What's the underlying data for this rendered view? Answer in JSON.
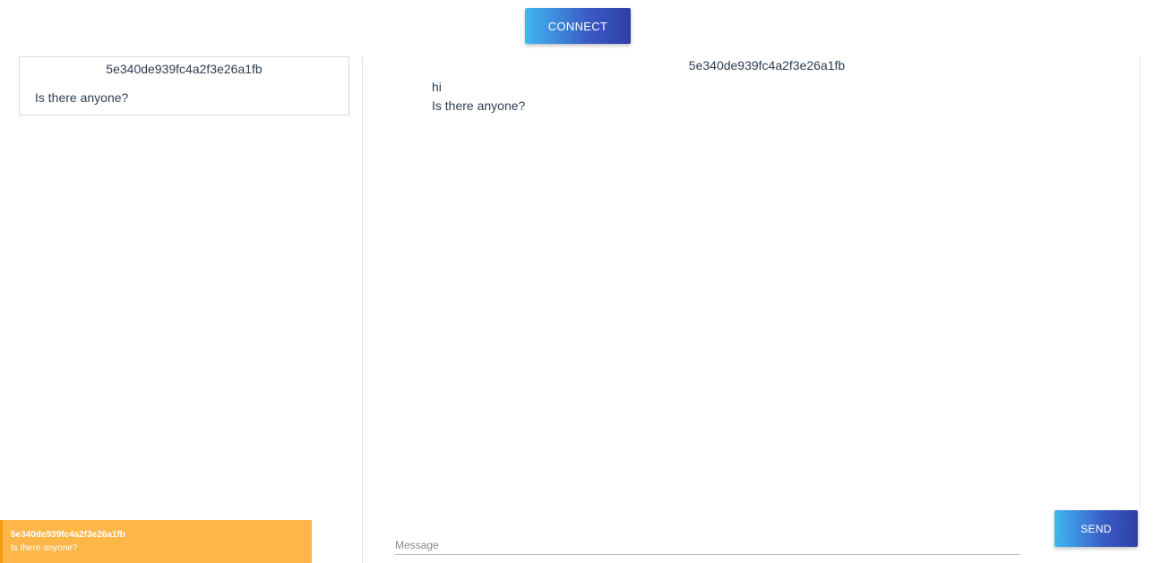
{
  "toolbar": {
    "connect_label": "CONNECT"
  },
  "conversations": [
    {
      "id": "5e340de939fc4a2f3e26a1fb",
      "last_message": "Is there anyone?"
    }
  ],
  "notification": {
    "title": "5e340de939fc4a2f3e26a1fb",
    "message": "Is there anyone?",
    "background_color": "#ffb648"
  },
  "chat": {
    "header": "5e340de939fc4a2f3e26a1fb",
    "messages": [
      {
        "text": "hi"
      },
      {
        "text": "Is there anyone?"
      }
    ]
  },
  "composer": {
    "placeholder": "Message",
    "value": "",
    "send_label": "SEND"
  },
  "colors": {
    "button_gradient_start": "#3fb8f1",
    "button_gradient_end": "#2f3fa6",
    "text": "#2c3e50"
  }
}
